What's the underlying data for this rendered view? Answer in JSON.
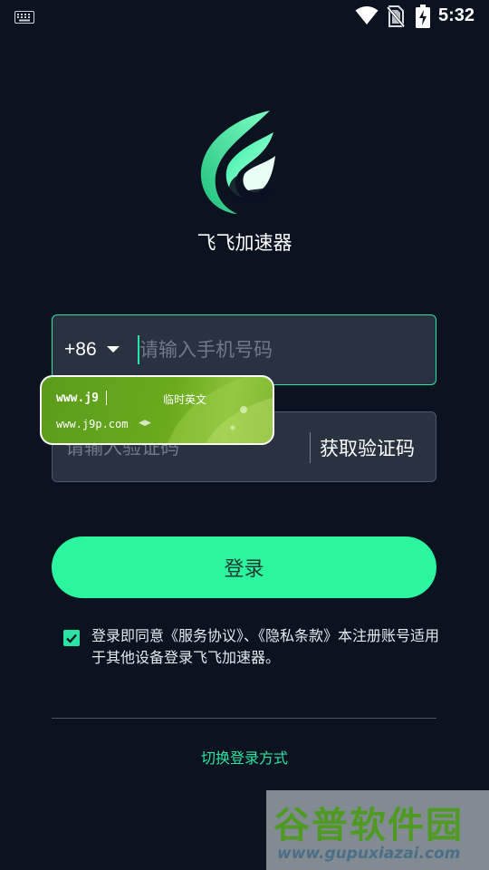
{
  "status_bar": {
    "time": "5:32",
    "icons": [
      "keyboard-icon",
      "wifi-icon",
      "no-sim-icon",
      "battery-charging-icon"
    ]
  },
  "app": {
    "name": "飞飞加速器",
    "logo_icon": "feifei-logo-icon",
    "accent_color": "#2be4a1",
    "background_color": "#0b1220"
  },
  "phone": {
    "country_code": "+86",
    "placeholder": "请输入手机号码",
    "value": ""
  },
  "code": {
    "placeholder": "请输入验证码",
    "value": "",
    "get_code_label": "获取验证码"
  },
  "ime": {
    "typed": "www.j9",
    "mode_label": "临时英文",
    "candidate": "www.j9p.com"
  },
  "login_label": "登录",
  "agreement": {
    "checked": true,
    "text": "登录即同意《服务协议》、《隐私条款》本注册账号适用于其他设备登录飞飞加速器。"
  },
  "switch_login_label": "切换登录方式",
  "watermark": {
    "title": "谷普软件园",
    "url": "www.gupuxiazai.com"
  }
}
